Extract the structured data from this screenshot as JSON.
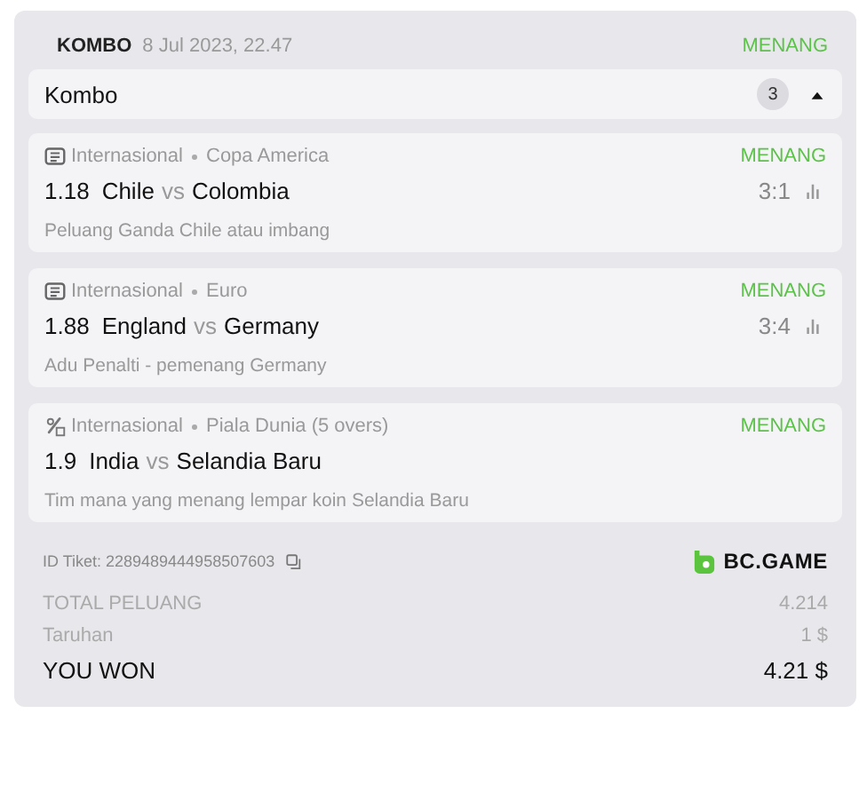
{
  "header": {
    "type": "KOMBO",
    "date": "8 Jul 2023, 22.47",
    "status": "MENANG"
  },
  "group": {
    "title": "Kombo",
    "count": "3",
    "expanded": true
  },
  "matches": [
    {
      "kind": "football",
      "category": "Internasional",
      "league": "Copa America",
      "status": "MENANG",
      "odds": "1.18",
      "home": "Chile",
      "vs": "vs",
      "away": "Colombia",
      "score": "3:1",
      "market": "Peluang Ganda Chile atau imbang"
    },
    {
      "kind": "football",
      "category": "Internasional",
      "league": "Euro",
      "status": "MENANG",
      "odds": "1.88",
      "home": "England",
      "vs": "vs",
      "away": "Germany",
      "score": "3:4",
      "market": "Adu Penalti - pemenang Germany"
    },
    {
      "kind": "cricket",
      "category": "Internasional",
      "league": "Piala Dunia (5 overs)",
      "status": "MENANG",
      "odds": "1.9",
      "home": "India",
      "vs": "vs",
      "away": "Selandia Baru",
      "market": "Tim mana yang menang lempar koin Selandia Baru"
    }
  ],
  "ticket": {
    "label": "ID Tiket: 2289489444958507603",
    "brand": "BC.GAME"
  },
  "summary": [
    {
      "kind": "muted-caps",
      "label": "TOTAL PELUANG",
      "value": "4.214"
    },
    {
      "kind": "muted",
      "label": "Taruhan",
      "value": "1 $"
    },
    {
      "kind": "strong",
      "label": "YOU WON",
      "value": "4.21 $"
    }
  ]
}
